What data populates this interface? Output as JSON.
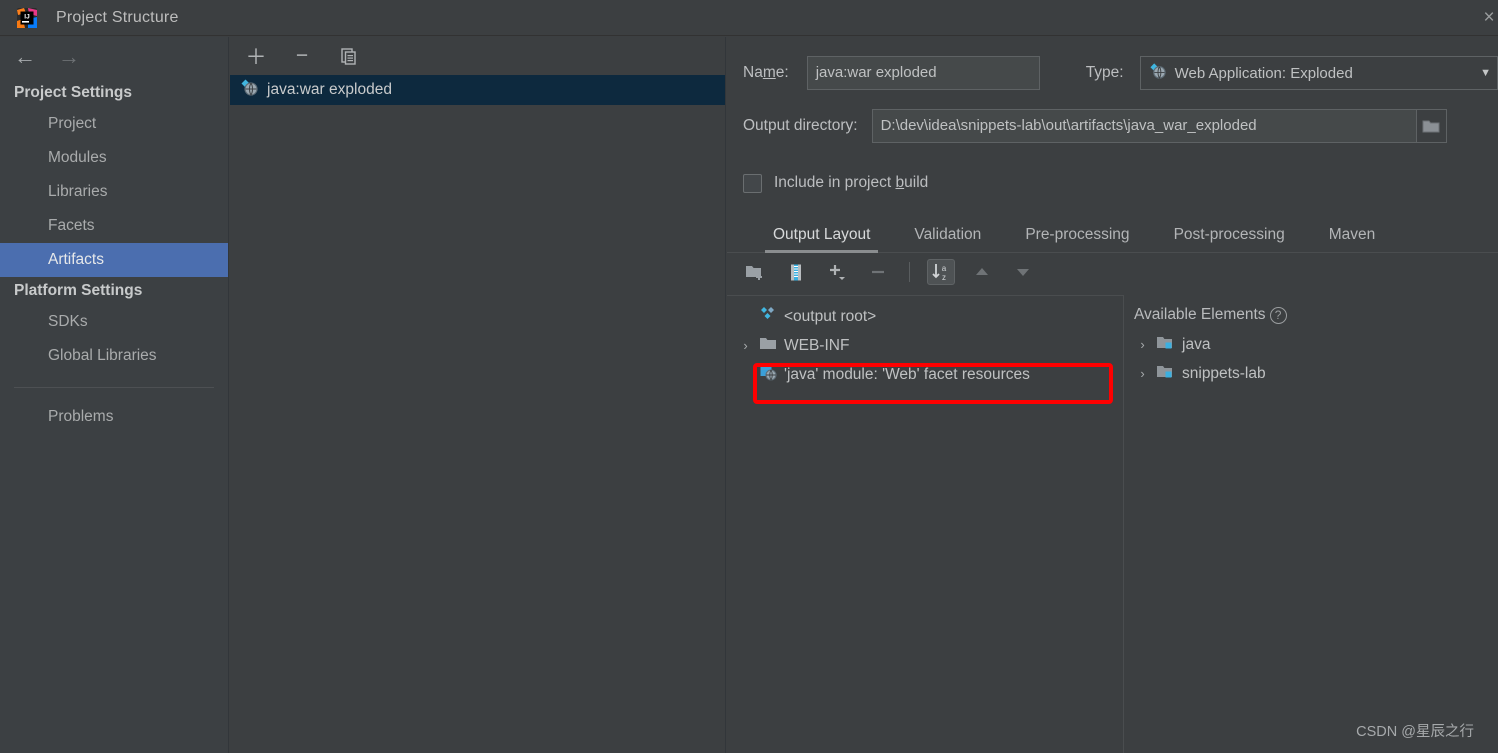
{
  "window": {
    "title": "Project Structure",
    "logo_icon": "intellij-idea-logo",
    "close_label": "×"
  },
  "nav": {
    "back_icon": "←",
    "forward_icon": "→"
  },
  "sidebar": {
    "groups": [
      {
        "label": "Project Settings",
        "items": [
          {
            "label": "Project",
            "selected": false
          },
          {
            "label": "Modules",
            "selected": false
          },
          {
            "label": "Libraries",
            "selected": false
          },
          {
            "label": "Facets",
            "selected": false
          },
          {
            "label": "Artifacts",
            "selected": true
          }
        ]
      },
      {
        "label": "Platform Settings",
        "items": [
          {
            "label": "SDKs",
            "selected": false
          },
          {
            "label": "Global Libraries",
            "selected": false
          }
        ]
      }
    ],
    "footer_items": [
      {
        "label": "Problems"
      }
    ],
    "selected_color": "#4b6eaf"
  },
  "artifacts_list": {
    "toolbar": [
      {
        "name": "add-artifact-button",
        "glyph": "＋"
      },
      {
        "name": "remove-artifact-button",
        "glyph": "−"
      },
      {
        "name": "copy-artifact-button",
        "glyph": "copy-icon"
      }
    ],
    "items": [
      {
        "label": "java:war exploded",
        "icon": "web-application-icon",
        "selected": true
      }
    ],
    "selection_bg": "#0d293e"
  },
  "detail": {
    "name_label_pre": "Na",
    "name_label_mn": "m",
    "name_label_post": "e:",
    "name_value": "java:war exploded",
    "type_label": "Type:",
    "type_value": "Web Application: Exploded",
    "type_icon": "web-application-icon",
    "output_dir_label": "Output directory:",
    "output_dir_value": "D:\\dev\\idea\\snippets-lab\\out\\artifacts\\java_war_exploded",
    "browse_icon": "folder-browse-icon",
    "include_build_pre": "Include in project ",
    "include_build_mn": "b",
    "include_build_post": "uild",
    "include_build_checked": false,
    "tabs": [
      {
        "label": "Output Layout",
        "active": true
      },
      {
        "label": "Validation",
        "active": false
      },
      {
        "label": "Pre-processing",
        "active": false
      },
      {
        "label": "Post-processing",
        "active": false
      },
      {
        "label": "Maven",
        "active": false
      }
    ],
    "layout_toolbar": [
      {
        "name": "create-directory-button",
        "icon": "new-folder-icon",
        "state": "enabled"
      },
      {
        "name": "create-archive-button",
        "icon": "archive-zip-icon",
        "state": "enabled"
      },
      {
        "name": "add-copy-of-button",
        "icon": "plus-dropdown-icon",
        "state": "enabled"
      },
      {
        "name": "remove-element-button",
        "icon": "minus-icon",
        "state": "disabled"
      },
      {
        "name": "sort-alphabetically-button",
        "icon": "sort-az-icon",
        "state": "pressed"
      },
      {
        "name": "move-up-button",
        "icon": "arrow-up-icon",
        "state": "disabled"
      },
      {
        "name": "move-down-button",
        "icon": "arrow-down-icon",
        "state": "disabled"
      }
    ],
    "output_tree": [
      {
        "label": "<output root>",
        "icon": "artifact-root-icon",
        "chevron": "",
        "indent": 0,
        "highlighted": false
      },
      {
        "label": "WEB-INF",
        "icon": "folder-icon",
        "chevron": "›",
        "indent": 0,
        "highlighted": false
      },
      {
        "label": "'java' module: 'Web' facet resources",
        "icon": "web-facet-resources-icon",
        "chevron": "",
        "indent": 0,
        "highlighted": true
      }
    ],
    "available": {
      "title": "Available Elements",
      "help_icon": "?",
      "items": [
        {
          "label": "java",
          "icon": "module-icon",
          "chevron": "›"
        },
        {
          "label": "snippets-lab",
          "icon": "module-icon",
          "chevron": "›"
        }
      ]
    }
  },
  "annotation": {
    "highlight_color": "#ff0000",
    "target": "'java' module: 'Web' facet resources"
  },
  "watermark": {
    "text": "CSDN @星辰之行"
  }
}
